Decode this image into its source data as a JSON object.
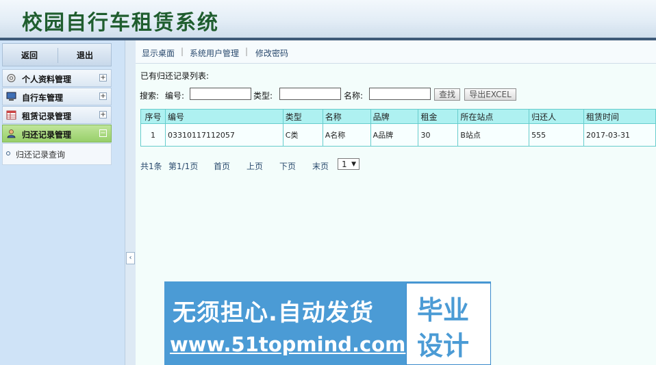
{
  "app": {
    "title": "校园自行车租赁系统"
  },
  "sidebar": {
    "back_label": "返回",
    "exit_label": "退出",
    "items": [
      {
        "label": "个人资料管理",
        "icon": "gear-icon",
        "toggle": "+"
      },
      {
        "label": "自行车管理",
        "icon": "monitor-icon",
        "toggle": "+"
      },
      {
        "label": "租赁记录管理",
        "icon": "table-icon",
        "toggle": "+"
      },
      {
        "label": "归还记录管理",
        "icon": "user-icon",
        "toggle": "−"
      }
    ],
    "submenu": [
      {
        "label": "归还记录查询"
      }
    ]
  },
  "nav": {
    "links": [
      "显示桌面",
      "系统用户管理",
      "修改密码"
    ]
  },
  "main": {
    "list_title": "已有归还记录列表:",
    "search": {
      "prefix": "搜索:",
      "code_label": "编号:",
      "type_label": "类型:",
      "name_label": "名称:",
      "code_value": "",
      "type_value": "",
      "name_value": "",
      "search_button": "查找",
      "export_button": "导出EXCEL"
    },
    "table": {
      "headers": [
        "序号",
        "编号",
        "类型",
        "名称",
        "品牌",
        "租金",
        "所在站点",
        "归还人",
        "租赁时间"
      ],
      "rows": [
        [
          "1",
          "03310117112057",
          "C类",
          "A名称",
          "A品牌",
          "30",
          "B站点",
          "555",
          "2017-03-31"
        ]
      ]
    },
    "pager": {
      "total": "共1条",
      "page_info": "第1/1页",
      "first": "首页",
      "prev": "上页",
      "next": "下页",
      "last": "末页",
      "select_value": "1"
    }
  },
  "splitter": {
    "handle_glyph": "‹"
  },
  "watermark": {
    "line1": "无须担心.自动发货",
    "line2": "www.51topmind.com",
    "box_line1": "毕业",
    "box_line2": "设计"
  },
  "colors": {
    "title_green": "#1f5d2e",
    "header_bar": "#3e5a78",
    "table_header": "#aef1f1",
    "table_border": "#66cccc",
    "active_menu": "#98cf6a",
    "watermark_blue": "#4b9bd5"
  }
}
